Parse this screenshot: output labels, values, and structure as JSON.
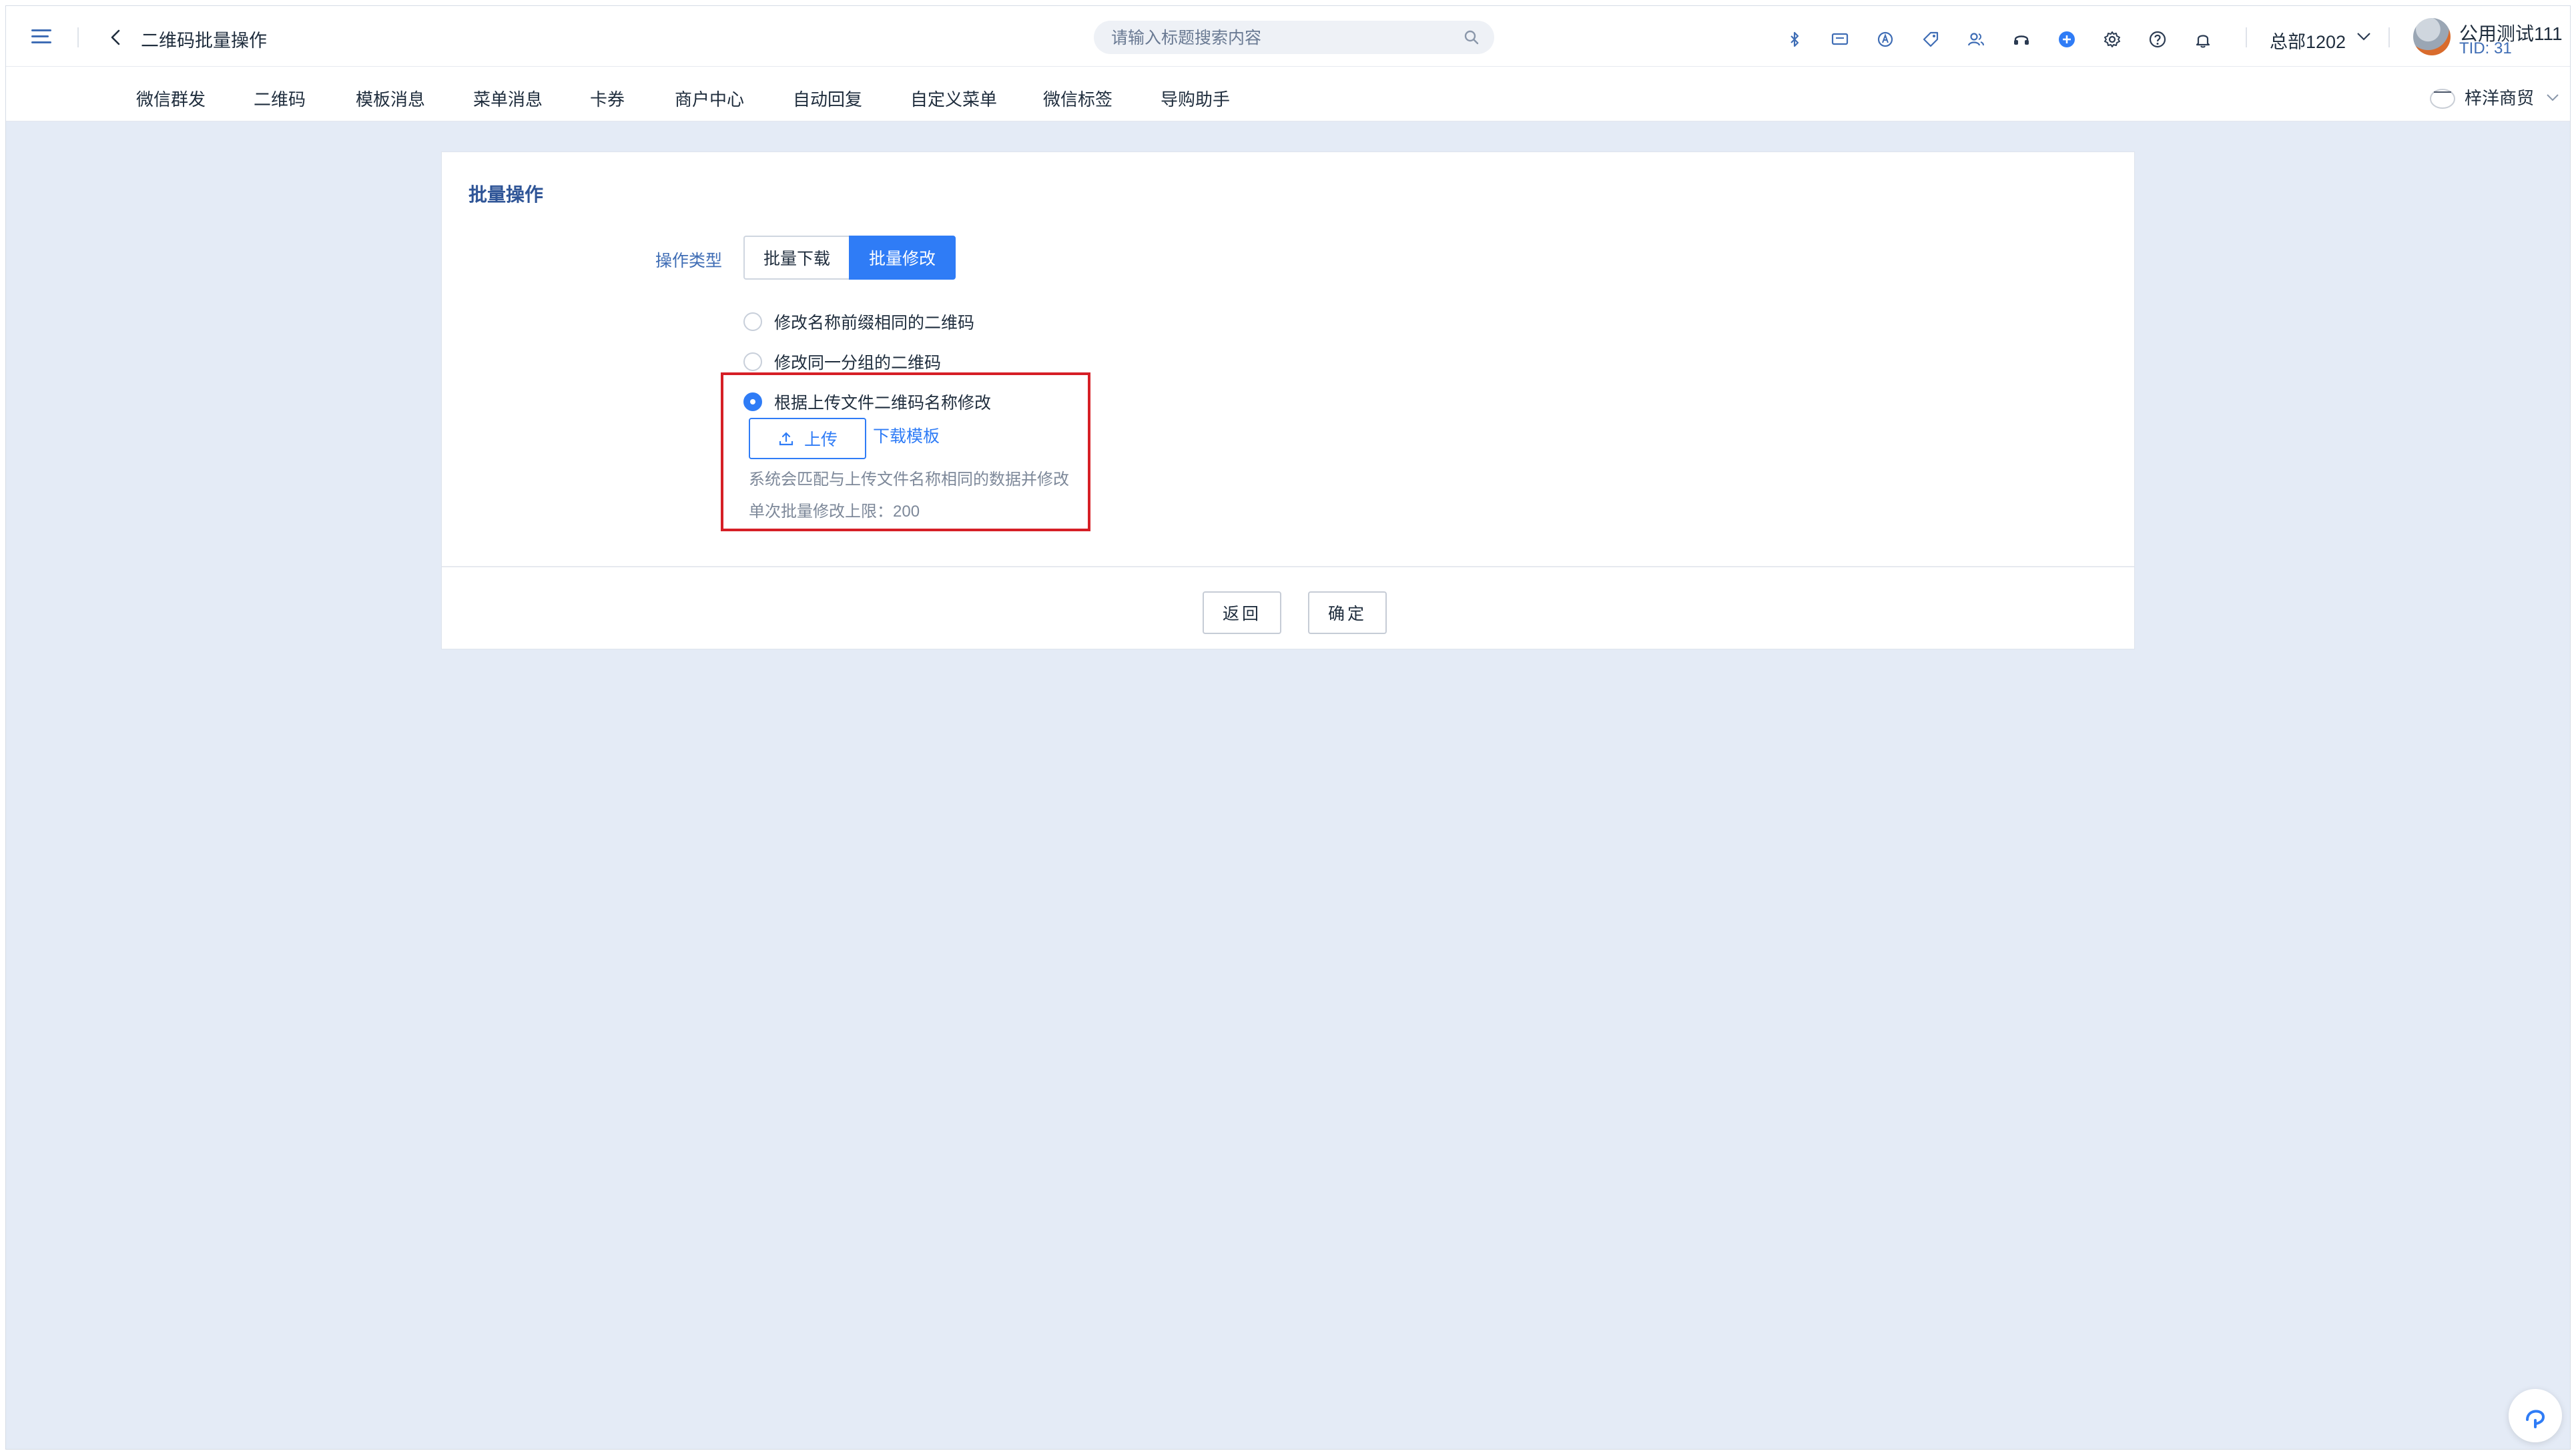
{
  "header": {
    "title": "二维码批量操作",
    "search_placeholder": "请输入标题搜索内容",
    "org": "总部1202",
    "user_name": "公用测试111",
    "user_tid": "TID: 31"
  },
  "nav": {
    "items": [
      "微信群发",
      "二维码",
      "模板消息",
      "菜单消息",
      "卡券",
      "商户中心",
      "自动回复",
      "自定义菜单",
      "微信标签",
      "导购助手"
    ],
    "merchant": "梓洋商贸"
  },
  "card": {
    "title": "批量操作",
    "op_label": "操作类型",
    "segments": {
      "download": "批量下载",
      "modify": "批量修改",
      "selected": "批量修改"
    },
    "options": [
      {
        "label": "修改名称前缀相同的二维码",
        "checked": false
      },
      {
        "label": "修改同一分组的二维码",
        "checked": false
      },
      {
        "label": "根据上传文件二维码名称修改",
        "checked": true
      }
    ],
    "upload_label": "上传",
    "download_template": "下载模板",
    "hint1": "系统会匹配与上传文件名称相同的数据并修改",
    "hint2": "单次批量修改上限：200",
    "back": "返回",
    "confirm": "确定"
  },
  "colors": {
    "accent": "#2f7cf6",
    "highlight": "#d61f26",
    "background": "#e4ebf6"
  }
}
